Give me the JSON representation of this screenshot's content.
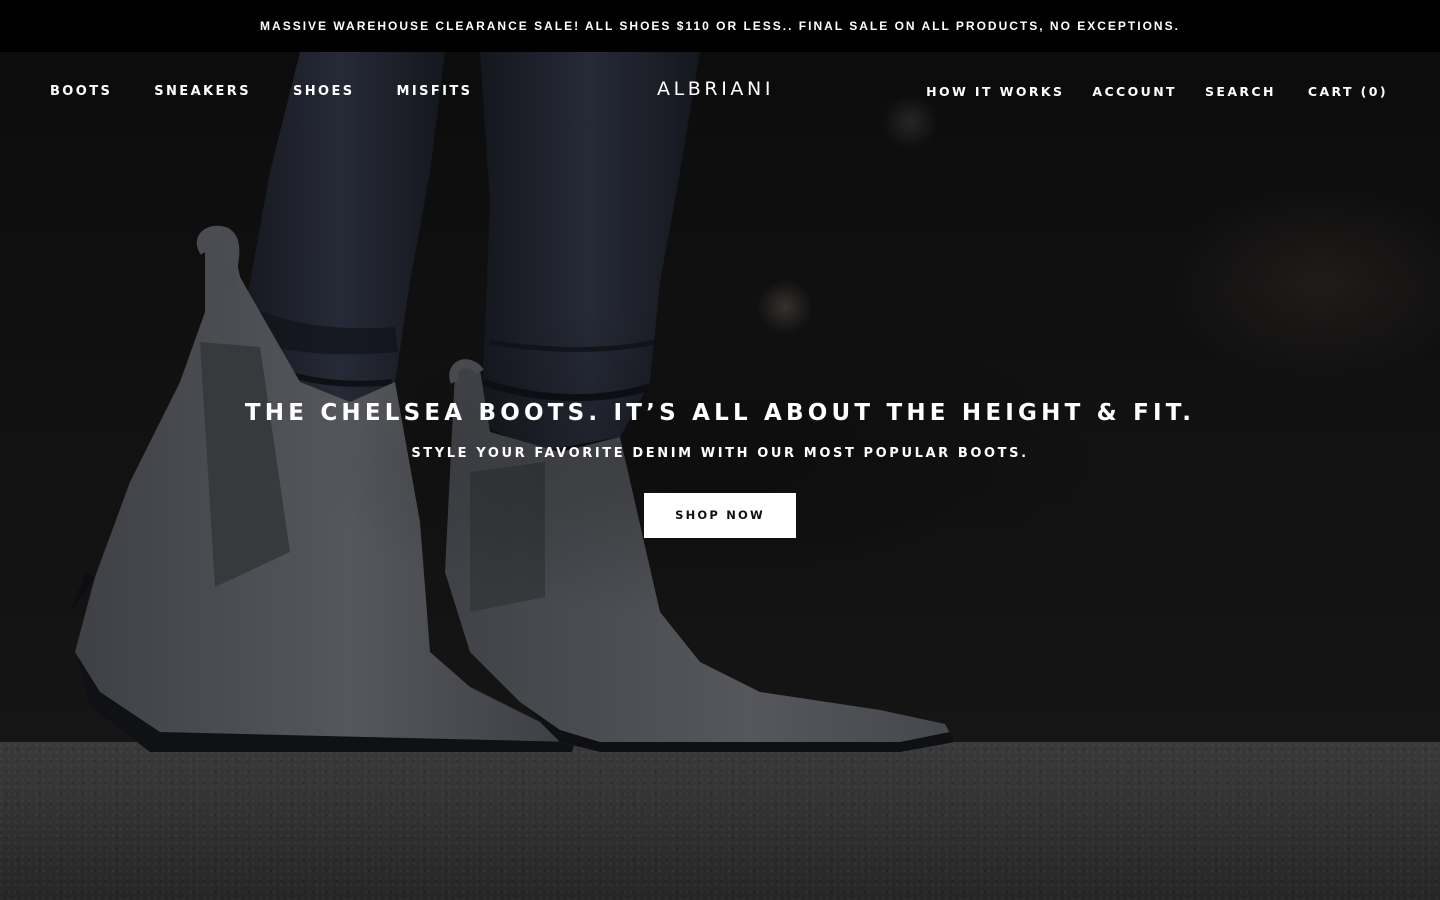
{
  "announcement": {
    "text": "MASSIVE WAREHOUSE CLEARANCE SALE! ALL SHOES $110 OR LESS.. FINAL SALE ON ALL PRODUCTS, NO EXCEPTIONS."
  },
  "header": {
    "logo": "ALBRIANI",
    "nav_left": [
      "BOOTS",
      "SNEAKERS",
      "SHOES",
      "MISFITS"
    ],
    "nav_right": {
      "how_it_works": "HOW IT WORKS",
      "account": "ACCOUNT",
      "search": "SEARCH",
      "cart": "CART (0)"
    }
  },
  "hero": {
    "title": "THE CHELSEA BOOTS. IT’S ALL ABOUT THE HEIGHT & FIT.",
    "subtitle": "STYLE YOUR FAVORITE DENIM WITH OUR MOST POPULAR BOOTS.",
    "cta_label": "SHOP NOW"
  },
  "colors": {
    "announcement_bg": "#000000",
    "text": "#ffffff",
    "cta_bg": "#ffffff",
    "cta_text": "#111111",
    "boot_suede": "#4f5156",
    "denim": "#1c1f28"
  }
}
